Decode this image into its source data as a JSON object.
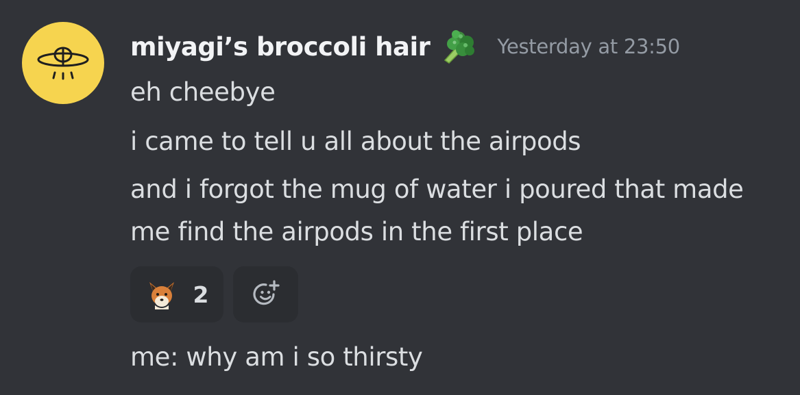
{
  "message": {
    "author": {
      "name": "miyagi’s broccoli hair",
      "role_icon": "broccoli-icon",
      "avatar_icon": "eye-symbol-icon",
      "avatar_color": "#f6d44f"
    },
    "timestamp": "Yesterday at 23:50",
    "lines": [
      "eh cheebye",
      "i came to tell u all about the airpods",
      "and i forgot the mug of water i poured that made",
      "me find the airpods in the first place"
    ],
    "reactions": [
      {
        "emoji": "fox-emoji",
        "count": "2"
      }
    ],
    "add_reaction_icon": "add-reaction-icon",
    "followup": "me: why am i so thirsty"
  },
  "colors": {
    "background": "#313338",
    "text": "#dbdee1",
    "username": "#f2f3f5",
    "timestamp": "#949ba4",
    "reaction_bg": "#2b2d31"
  }
}
